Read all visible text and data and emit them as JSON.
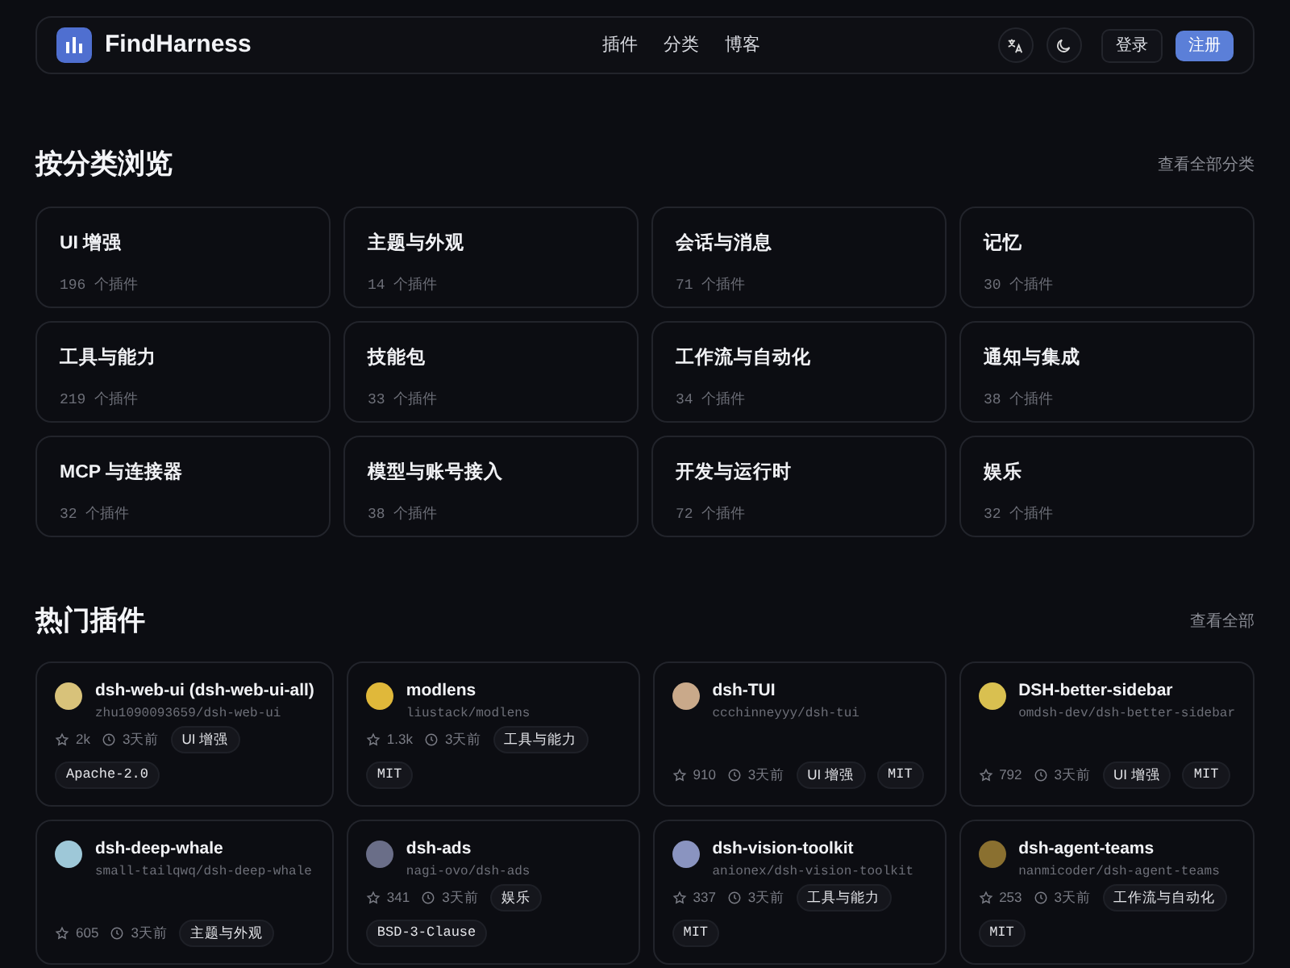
{
  "navbar": {
    "brand": "FindHarness",
    "links": [
      "插件",
      "分类",
      "博客"
    ],
    "login": "登录",
    "register": "注册"
  },
  "categories_section": {
    "title": "按分类浏览",
    "view_all": "查看全部分类",
    "categories": [
      {
        "name": "UI 增强",
        "count": "196",
        "unit": "个插件"
      },
      {
        "name": "主题与外观",
        "count": "14",
        "unit": "个插件"
      },
      {
        "name": "会话与消息",
        "count": "71",
        "unit": "个插件"
      },
      {
        "name": "记忆",
        "count": "30",
        "unit": "个插件"
      },
      {
        "name": "工具与能力",
        "count": "219",
        "unit": "个插件"
      },
      {
        "name": "技能包",
        "count": "33",
        "unit": "个插件"
      },
      {
        "name": "工作流与自动化",
        "count": "34",
        "unit": "个插件"
      },
      {
        "name": "通知与集成",
        "count": "38",
        "unit": "个插件"
      },
      {
        "name": "MCP 与连接器",
        "count": "32",
        "unit": "个插件"
      },
      {
        "name": "模型与账号接入",
        "count": "38",
        "unit": "个插件"
      },
      {
        "name": "开发与运行时",
        "count": "72",
        "unit": "个插件"
      },
      {
        "name": "娱乐",
        "count": "32",
        "unit": "个插件"
      }
    ]
  },
  "hot_section": {
    "title": "热门插件",
    "view_all": "查看全部",
    "plugins": [
      {
        "name": "dsh-web-ui (dsh-web-ui-all)",
        "repo": "zhu1090093659/dsh-web-ui",
        "stars": "2k",
        "updated": "3天前",
        "category": "UI 增强",
        "license": "Apache-2.0",
        "color": "#d8c27a"
      },
      {
        "name": "modlens",
        "repo": "liustack/modlens",
        "stars": "1.3k",
        "updated": "3天前",
        "category": "工具与能力",
        "license": "MIT",
        "color": "#e0b83a"
      },
      {
        "name": "dsh-TUI",
        "repo": "ccchinneyyy/dsh-tui",
        "stars": "910",
        "updated": "3天前",
        "category": "UI 增强",
        "license": "MIT",
        "color": "#c9a98a"
      },
      {
        "name": "DSH-better-sidebar",
        "repo": "omdsh-dev/dsh-better-sidebar",
        "stars": "792",
        "updated": "3天前",
        "category": "UI 增强",
        "license": "MIT",
        "color": "#d9c050"
      },
      {
        "name": "dsh-deep-whale",
        "repo": "small-tailqwq/dsh-deep-whale",
        "stars": "605",
        "updated": "3天前",
        "category": "主题与外观",
        "color": "#9ec8d8"
      },
      {
        "name": "dsh-ads",
        "repo": "nagi-ovo/dsh-ads",
        "stars": "341",
        "updated": "3天前",
        "category": "娱乐",
        "license": "BSD-3-Clause",
        "color": "#6a6e88"
      },
      {
        "name": "dsh-vision-toolkit",
        "repo": "anionex/dsh-vision-toolkit",
        "stars": "337",
        "updated": "3天前",
        "category": "工具与能力",
        "license": "MIT",
        "color": "#8a94c0"
      },
      {
        "name": "dsh-agent-teams",
        "repo": "nanmicoder/dsh-agent-teams",
        "stars": "253",
        "updated": "3天前",
        "category": "工作流与自动化",
        "license": "MIT",
        "color": "#8a7030"
      }
    ]
  }
}
